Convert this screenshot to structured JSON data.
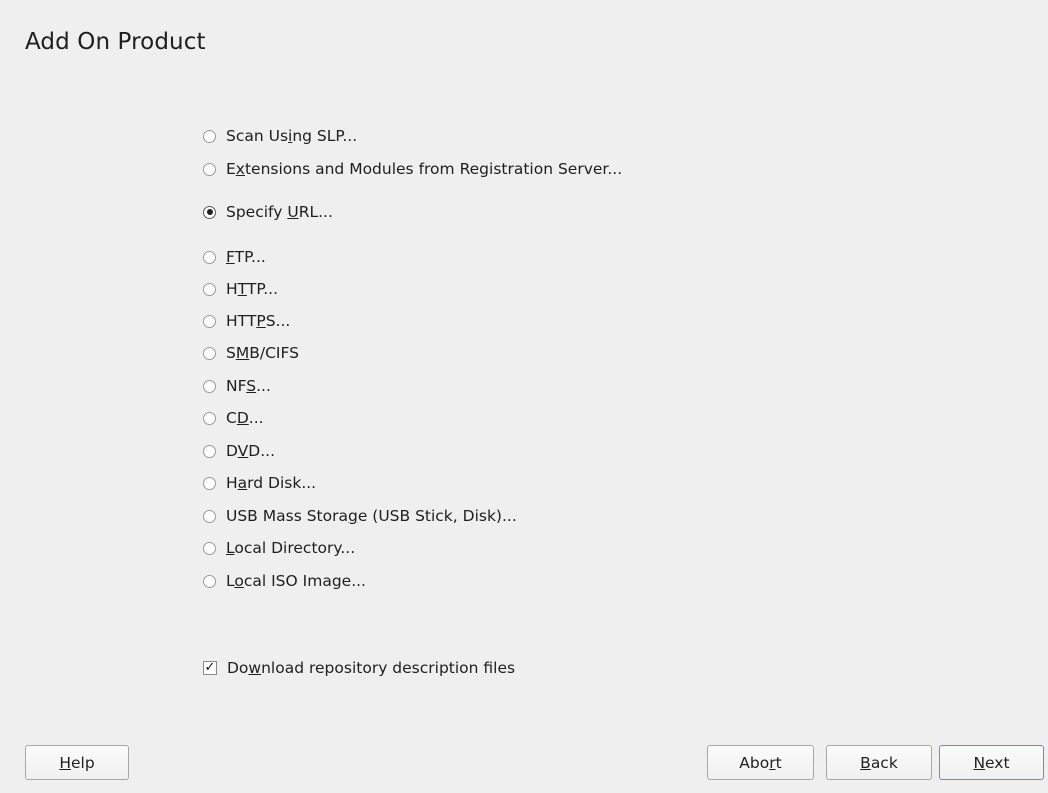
{
  "window": {
    "title": "Add On Product"
  },
  "sources": [
    {
      "pre": "Scan Us",
      "key": "i",
      "post": "ng SLP...",
      "checked": false
    },
    {
      "pre": "E",
      "key": "x",
      "post": "tensions and Modules from Registration Server...",
      "checked": false
    },
    {
      "pre": "Specify ",
      "key": "U",
      "post": "RL...",
      "checked": true
    },
    {
      "pre": "",
      "key": "F",
      "post": "TP...",
      "checked": false
    },
    {
      "pre": "H",
      "key": "T",
      "post": "TP...",
      "checked": false
    },
    {
      "pre": "HTT",
      "key": "P",
      "post": "S...",
      "checked": false
    },
    {
      "pre": "S",
      "key": "M",
      "post": "B/CIFS",
      "checked": false
    },
    {
      "pre": "NF",
      "key": "S",
      "post": "...",
      "checked": false
    },
    {
      "pre": "C",
      "key": "D",
      "post": "...",
      "checked": false
    },
    {
      "pre": "D",
      "key": "V",
      "post": "D...",
      "checked": false
    },
    {
      "pre": "H",
      "key": "a",
      "post": "rd Disk...",
      "checked": false
    },
    {
      "pre": "USB Mass Stora",
      "key": "g",
      "post": "e (USB Stick, Disk)...",
      "checked": false
    },
    {
      "pre": "",
      "key": "L",
      "post": "ocal Directory...",
      "checked": false
    },
    {
      "pre": "L",
      "key": "o",
      "post": "cal ISO Image...",
      "checked": false
    }
  ],
  "download": {
    "pre": "Do",
    "key": "w",
    "post": "nload repository description files",
    "checked": true,
    "check_glyph": "✓"
  },
  "buttons": {
    "help": {
      "pre": "",
      "key": "H",
      "post": "elp"
    },
    "abort": {
      "pre": "Abo",
      "key": "r",
      "post": "t"
    },
    "back": {
      "pre": "",
      "key": "B",
      "post": "ack"
    },
    "next": {
      "pre": "",
      "key": "N",
      "post": "ext"
    }
  }
}
